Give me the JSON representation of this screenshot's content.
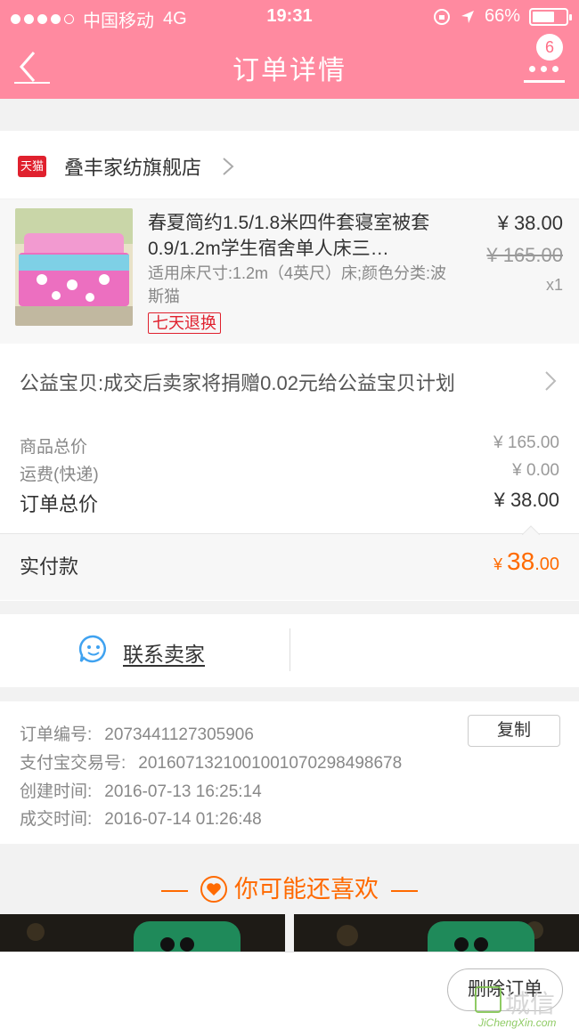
{
  "status_bar": {
    "carrier": "中国移动",
    "network": "4G",
    "time": "19:31",
    "battery": "66%",
    "battery_level": 0.66
  },
  "nav": {
    "title": "订单详情",
    "badge_count": "6"
  },
  "store": {
    "badge": "天猫",
    "name": "叠丰家纺旗舰店"
  },
  "product": {
    "title": "春夏简约1.5/1.8米四件套寝室被套0.9/1.2m学生宿舍单人床三…",
    "sku": "适用床尺寸:1.2m（4英尺）床;颜色分类:波斯猫",
    "tag": "七天退换",
    "price": "¥ 38.00",
    "original_price": "¥ 165.00",
    "quantity": "x1"
  },
  "charity": {
    "text": "公益宝贝:成交后卖家将捐赠0.02元给公益宝贝计划"
  },
  "summary": {
    "goods_total_label": "商品总价",
    "goods_total_value": "¥ 165.00",
    "shipping_label": "运费(快递)",
    "shipping_value": "¥ 0.00",
    "order_total_label": "订单总价",
    "order_total_value": "¥ 38.00",
    "paid_label": "实付款",
    "paid_symbol": "¥ ",
    "paid_integer": "38",
    "paid_decimal": ".00"
  },
  "contact": {
    "label": "联系卖家"
  },
  "order_info": {
    "order_no_label": "订单编号:",
    "order_no": "2073441127305906",
    "alipay_label": "支付宝交易号:",
    "alipay_no": "2016071321001001070298498678",
    "created_label": "创建时间:",
    "created": "2016-07-13 16:25:14",
    "deal_label": "成交时间:",
    "deal": "2016-07-14 01:26:48",
    "copy_button": "复制"
  },
  "recommend": {
    "title": "你可能还喜欢"
  },
  "bottom": {
    "delete_button": "删除订单"
  },
  "watermark": {
    "text": "城信",
    "site": "JiChengXin.com"
  },
  "colors": {
    "nav_bg": "#ff8aa0",
    "accent_orange": "#ff6a00",
    "tmall_red": "#e0212e",
    "contact_blue": "#3fa2f0"
  }
}
